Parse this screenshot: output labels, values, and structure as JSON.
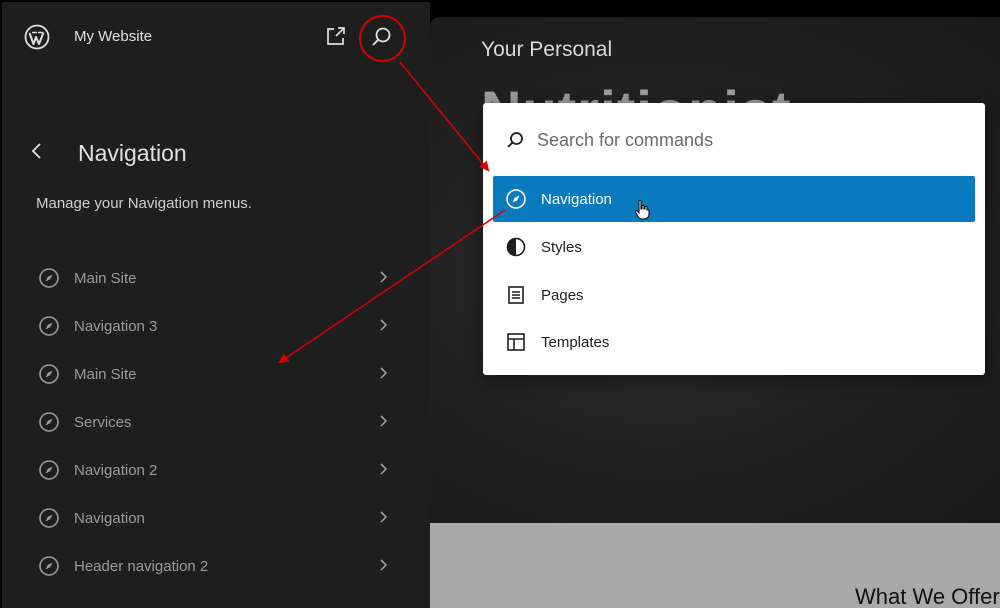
{
  "site": {
    "title": "My Website"
  },
  "panel": {
    "title": "Navigation",
    "description": "Manage your Navigation menus."
  },
  "nav_items": [
    {
      "label": "Main Site"
    },
    {
      "label": "Navigation 3"
    },
    {
      "label": "Main Site"
    },
    {
      "label": "Services"
    },
    {
      "label": "Navigation 2"
    },
    {
      "label": "Navigation"
    },
    {
      "label": "Header navigation 2"
    }
  ],
  "preview": {
    "subtitle": "Your Personal",
    "title": "Nutritionist",
    "section": "What We Offer"
  },
  "palette": {
    "placeholder": "Search for commands",
    "commands": [
      {
        "label": "Navigation",
        "icon": "compass-icon",
        "active": true
      },
      {
        "label": "Styles",
        "icon": "half-circle-icon"
      },
      {
        "label": "Pages",
        "icon": "page-icon"
      },
      {
        "label": "Templates",
        "icon": "layout-icon"
      }
    ]
  },
  "colors": {
    "sidebar_bg": "#1e1e1e",
    "accent": "#0a7abf",
    "annotation": "#d40000"
  }
}
